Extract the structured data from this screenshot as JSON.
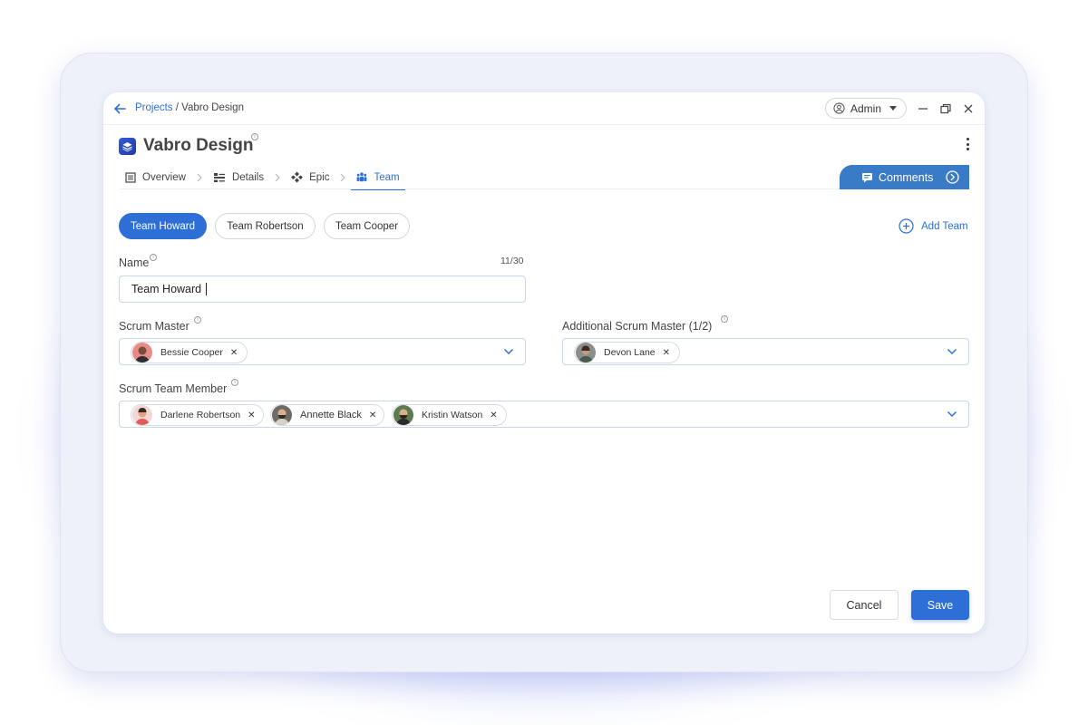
{
  "breadcrumb": {
    "projects": "Projects",
    "separator": " / ",
    "current": "Vabro Design"
  },
  "user_menu": {
    "label": "Admin"
  },
  "project": {
    "title": "Vabro Design"
  },
  "tabs": [
    {
      "label": "Overview",
      "icon": "list-icon"
    },
    {
      "label": "Details",
      "icon": "details-icon"
    },
    {
      "label": "Epic",
      "icon": "epic-icon"
    },
    {
      "label": "Team",
      "icon": "team-icon",
      "active": true
    }
  ],
  "comments": {
    "label": "Comments"
  },
  "teams": [
    {
      "label": "Team Howard",
      "active": true
    },
    {
      "label": "Team Robertson"
    },
    {
      "label": "Team Cooper"
    }
  ],
  "add_team_label": "Add Team",
  "form": {
    "name_label": "Name",
    "name_value": "Team Howard",
    "name_counter": "11/30",
    "scrum_master_label": "Scrum Master",
    "scrum_master": [
      "Bessie Cooper"
    ],
    "additional_label": "Additional Scrum Master (1/2)",
    "additional": [
      "Devon Lane"
    ],
    "members_label": "Scrum Team Member",
    "members": [
      "Darlene Robertson",
      "Annette Black",
      "Kristin Watson"
    ]
  },
  "actions": {
    "cancel": "Cancel",
    "save": "Save"
  },
  "colors": {
    "accent": "#2d6fd6",
    "comments_bg": "#3a7bc8"
  }
}
